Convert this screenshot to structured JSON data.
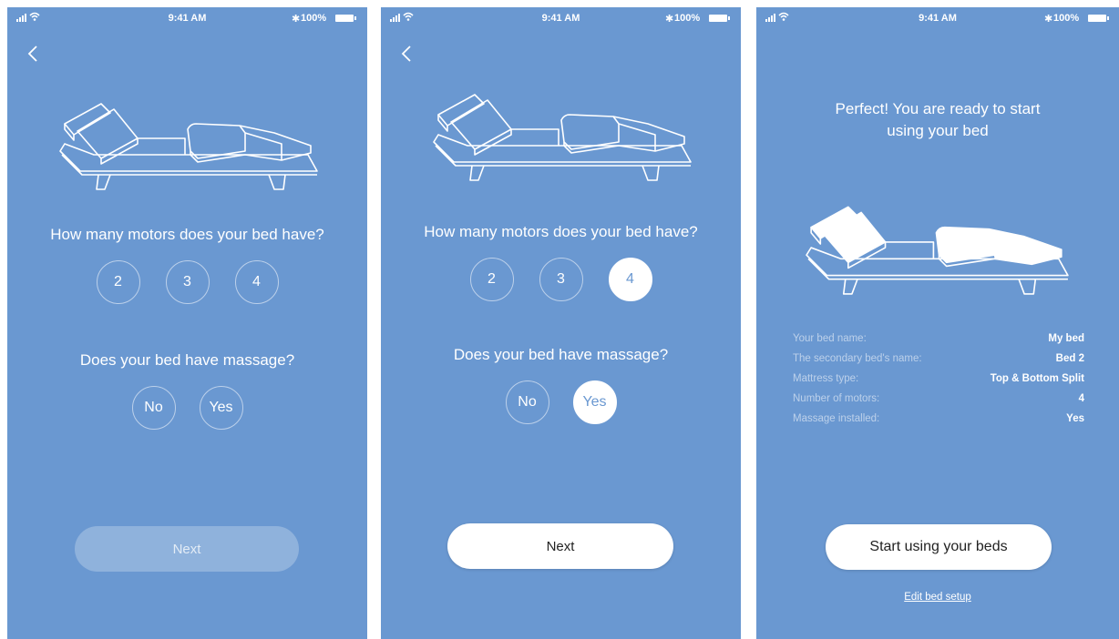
{
  "status": {
    "time": "9:41 AM",
    "battery": "100%"
  },
  "screen1": {
    "motors_question": "How many motors does your bed have?",
    "motor_options": [
      "2",
      "3",
      "4"
    ],
    "massage_question": "Does your bed have massage?",
    "massage_options": [
      "No",
      "Yes"
    ],
    "next_label": "Next"
  },
  "screen2": {
    "motors_question": "How many motors does your bed have?",
    "motor_options": [
      "2",
      "3",
      "4"
    ],
    "selected_motor": "4",
    "massage_question": "Does your bed have massage?",
    "massage_options": [
      "No",
      "Yes"
    ],
    "selected_massage": "Yes",
    "next_label": "Next"
  },
  "screen3": {
    "title_line1": "Perfect! You are ready to start",
    "title_line2": "using your bed",
    "summary": [
      {
        "label": "Your bed name:",
        "value": "My bed"
      },
      {
        "label": "The secondary bed's name:",
        "value": "Bed 2"
      },
      {
        "label": "Mattress type:",
        "value": "Top & Bottom Split"
      },
      {
        "label": "Number of motors:",
        "value": "4"
      },
      {
        "label": "Massage installed:",
        "value": "Yes"
      }
    ],
    "start_label": "Start using your beds",
    "edit_link": "Edit bed setup"
  },
  "colors": {
    "background": "#6a98d1",
    "button": "#ffffff",
    "accent_text": "#6a98d1"
  },
  "icons": [
    "signal-icon",
    "wifi-icon",
    "bluetooth-icon",
    "battery-icon",
    "back-chevron-icon",
    "adjustable-bed-illustration"
  ]
}
